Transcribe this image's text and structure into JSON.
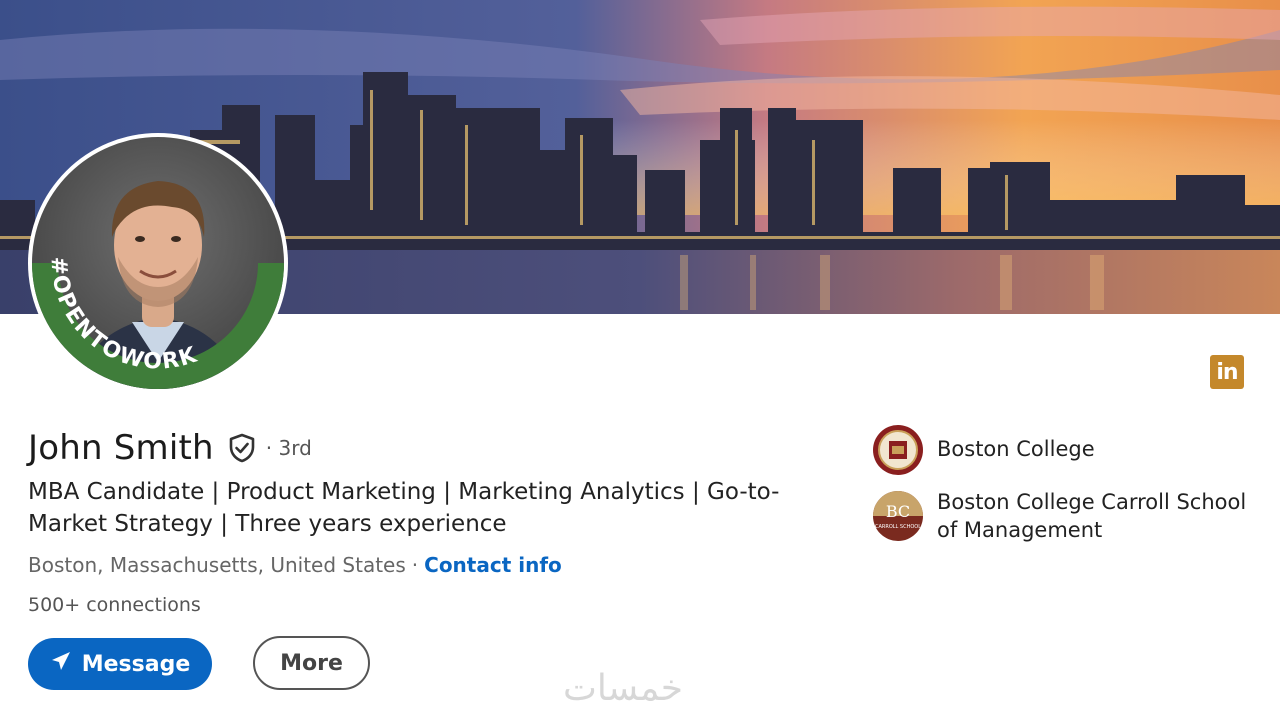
{
  "profile": {
    "name": "John Smith",
    "degree": "· 3rd",
    "headline": "MBA Candidate | Product Marketing | Marketing Analytics | Go-to-Market Strategy | Three years experience",
    "location": "Boston, Massachusetts, United States",
    "separator": "·",
    "contact_info": "Contact info",
    "connections": "500+ connections",
    "open_to_work_badge": "#OPENTOWORK"
  },
  "actions": {
    "message_label": "Message",
    "more_label": "More"
  },
  "education": [
    {
      "name": "Boston College",
      "logo": "boston-college-seal"
    },
    {
      "name": "Boston College Carroll School of Management",
      "logo": "bc-carroll-logo",
      "logo_text": "BC",
      "logo_subtext": "CARROLL SCHOOL"
    }
  ],
  "brand": {
    "linkedin_mark": "in",
    "linkedin_color": "#c4882b",
    "accent": "#0a66c2",
    "opentowork_green": "#3f7d3a"
  },
  "watermark": "خمسات"
}
